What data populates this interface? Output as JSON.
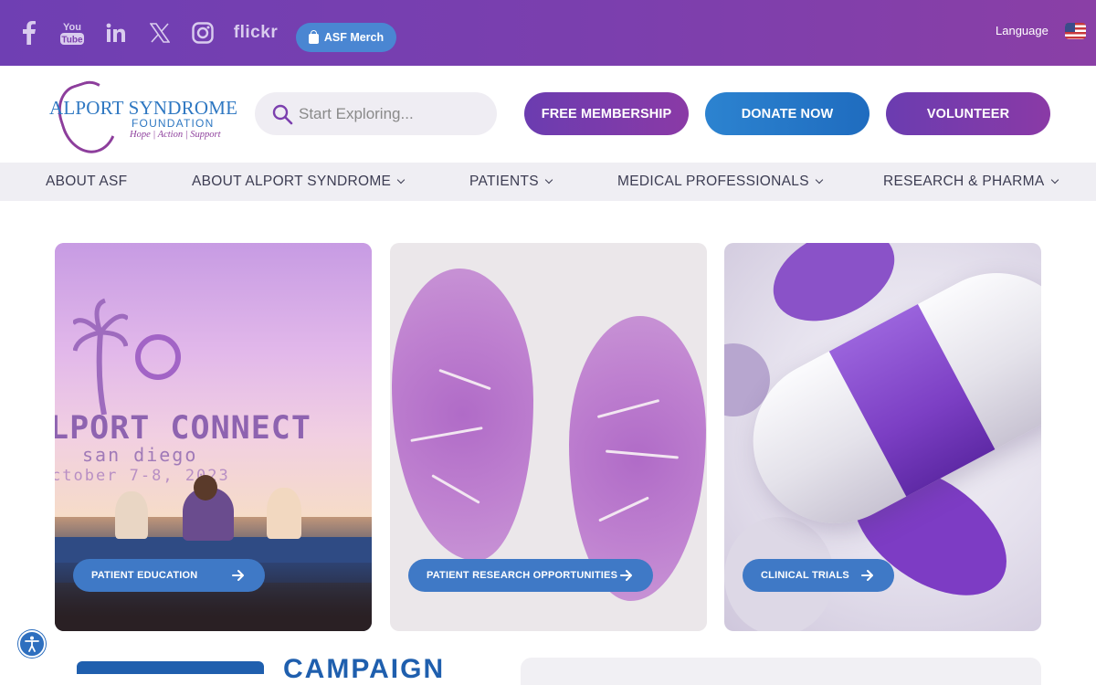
{
  "topbar": {
    "social": [
      {
        "name": "facebook"
      },
      {
        "name": "youtube"
      },
      {
        "name": "linkedin"
      },
      {
        "name": "x"
      },
      {
        "name": "instagram"
      },
      {
        "name": "flickr",
        "label": "flickr"
      }
    ],
    "merch_label": "ASF Merch",
    "language_label": "Language",
    "flag_icon": "us-flag-icon"
  },
  "header": {
    "logo": {
      "line1": "ALPORT SYNDROME",
      "line2": "FOUNDATION",
      "tagline": "Hope | Action | Support"
    },
    "search": {
      "placeholder": "Start Exploring..."
    },
    "buttons": {
      "membership": "FREE MEMBERSHIP",
      "donate": "DONATE NOW",
      "volunteer": "VOLUNTEER"
    }
  },
  "nav": {
    "items": [
      {
        "label": "ABOUT ASF",
        "dropdown": false
      },
      {
        "label": "ABOUT ALPORT SYNDROME",
        "dropdown": true
      },
      {
        "label": "PATIENTS",
        "dropdown": true
      },
      {
        "label": "MEDICAL PROFESSIONALS",
        "dropdown": true
      },
      {
        "label": "RESEARCH & PHARMA",
        "dropdown": true
      }
    ]
  },
  "cards": [
    {
      "button": "PATIENT EDUCATION",
      "image": {
        "title": "LPORT CONNECT",
        "subtitle": "san diego",
        "date": "ctober 7-8, 2023"
      }
    },
    {
      "button": "PATIENT RESEARCH OPPORTUNITIES"
    },
    {
      "button": "CLINICAL TRIALS"
    }
  ],
  "bottom": {
    "campaign_text": "CAMPAIGN"
  },
  "colors": {
    "brand_purple": "#7b3fae",
    "brand_blue": "#2f78c2",
    "button_blue": "#3f79c6"
  }
}
